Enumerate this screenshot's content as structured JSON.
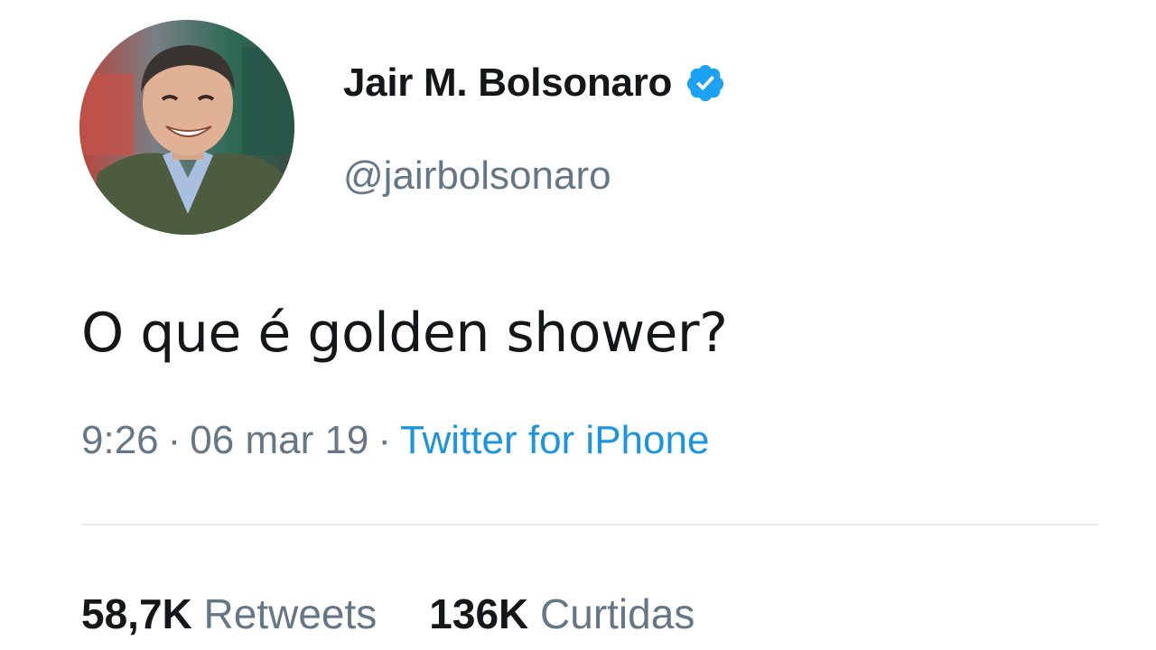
{
  "tweet": {
    "author": {
      "display_name": "Jair M. Bolsonaro",
      "handle": "@jairbolsonaro",
      "verified": true,
      "avatar_icon": "profile-photo"
    },
    "text": "O que é golden shower?",
    "meta": {
      "time": "9:26",
      "date": "06 mar 19",
      "separator": "·",
      "source": "Twitter for iPhone"
    },
    "stats": {
      "retweets_count": "58,7K",
      "retweets_label": "Retweets",
      "likes_count": "136K",
      "likes_label": "Curtidas"
    }
  },
  "colors": {
    "text_primary": "#14171a",
    "text_secondary": "#657786",
    "link": "#1b95e0",
    "verified_badge": "#1da1f2",
    "divider": "#e6ecf0"
  }
}
